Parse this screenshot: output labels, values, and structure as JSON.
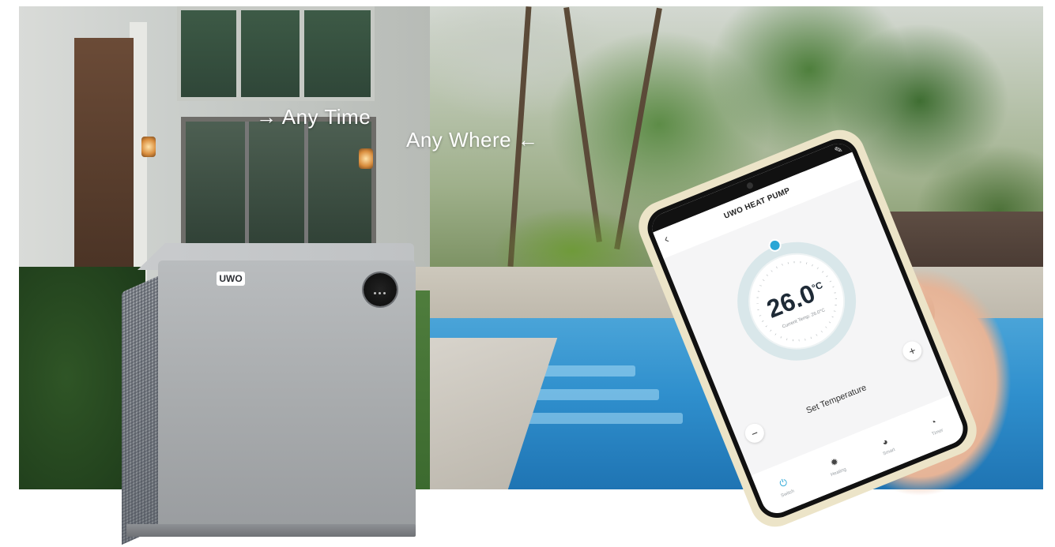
{
  "slogans": {
    "line1": "→ Any Time",
    "line2": "Any Where ←"
  },
  "unit": {
    "brand": "UWO"
  },
  "app": {
    "title": "UWO HEAT PUMP",
    "temperature": "26.0",
    "unit_symbol": "°C",
    "current_temp_label": "Current Temp: 26.0°C",
    "set_temperature_label": "Set Temperature",
    "minus": "−",
    "plus": "+",
    "tabs": [
      {
        "label": "Switch",
        "icon": "power-icon"
      },
      {
        "label": "Heating",
        "icon": "sun-icon"
      },
      {
        "label": "Smart",
        "icon": "smart-icon"
      },
      {
        "label": "Timer",
        "icon": "clock-icon"
      }
    ]
  },
  "colors": {
    "accent": "#2aa6d6",
    "pool": "#2f8fcd"
  }
}
